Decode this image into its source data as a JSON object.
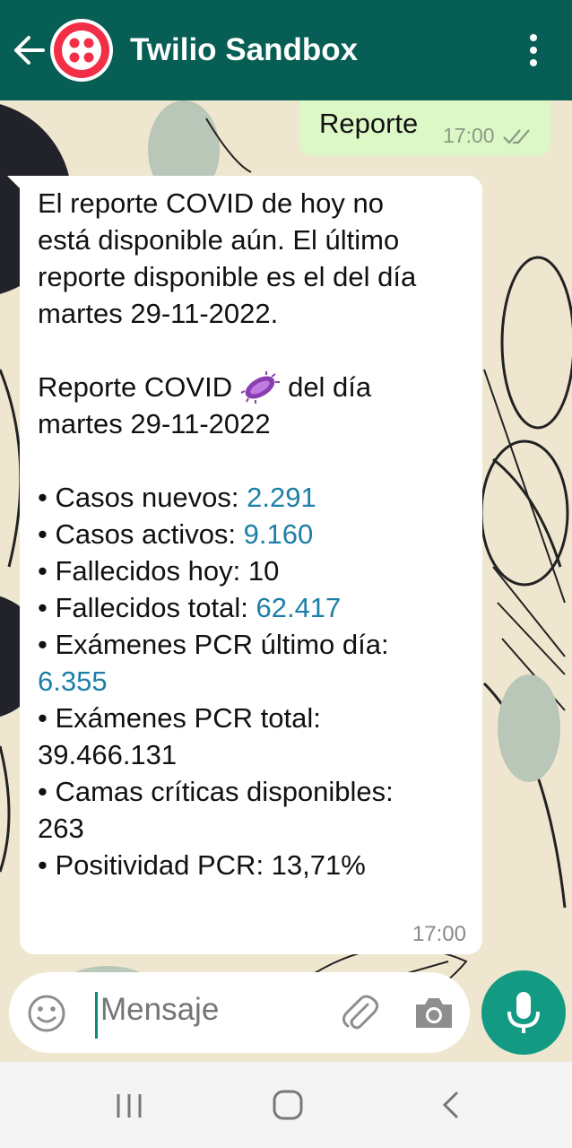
{
  "header": {
    "title": "Twilio Sandbox",
    "color": "#075e54"
  },
  "outgoing": {
    "text": "Reporte",
    "time": "17:00",
    "status": "delivered-double-check"
  },
  "incoming": {
    "lines": [
      "El reporte COVID de hoy no",
      "está disponible aún. El último",
      "reporte disponible es el del día",
      "martes 29-11-2022."
    ],
    "report_title_prefix": "Reporte COVID",
    "report_title_suffix": "del día",
    "report_date": "martes 29-11-2022",
    "stats": {
      "casos_nuevos_label": "• Casos nuevos: ",
      "casos_nuevos_value": "2.291",
      "casos_activos_label": "• Casos activos: ",
      "casos_activos_value": "9.160",
      "fallecidos_hoy": "• Fallecidos hoy: 10",
      "fallecidos_total_label": "• Fallecidos total: ",
      "fallecidos_total_value": "62.417",
      "examenes_ultimo_label": "• Exámenes PCR último día:",
      "examenes_ultimo_value": "6.355",
      "examenes_total_label": "• Exámenes PCR total:",
      "examenes_total_value": "39.466.131",
      "camas_label": "• Camas críticas disponibles:",
      "camas_value": "263",
      "positividad": "• Positividad PCR: 13,71%"
    },
    "time": "17:00"
  },
  "composer": {
    "placeholder": "Mensaje"
  },
  "colors": {
    "accent": "#139a83",
    "link_number": "#1d7fa8",
    "outgoing_bubble": "#dcf8c6"
  },
  "icons": [
    "back-arrow-icon",
    "twilio-logo-icon",
    "more-vert-icon",
    "emoji-icon",
    "attach-icon",
    "camera-icon",
    "mic-icon",
    "microbe-icon",
    "recent-apps-icon",
    "home-icon",
    "nav-back-icon"
  ]
}
